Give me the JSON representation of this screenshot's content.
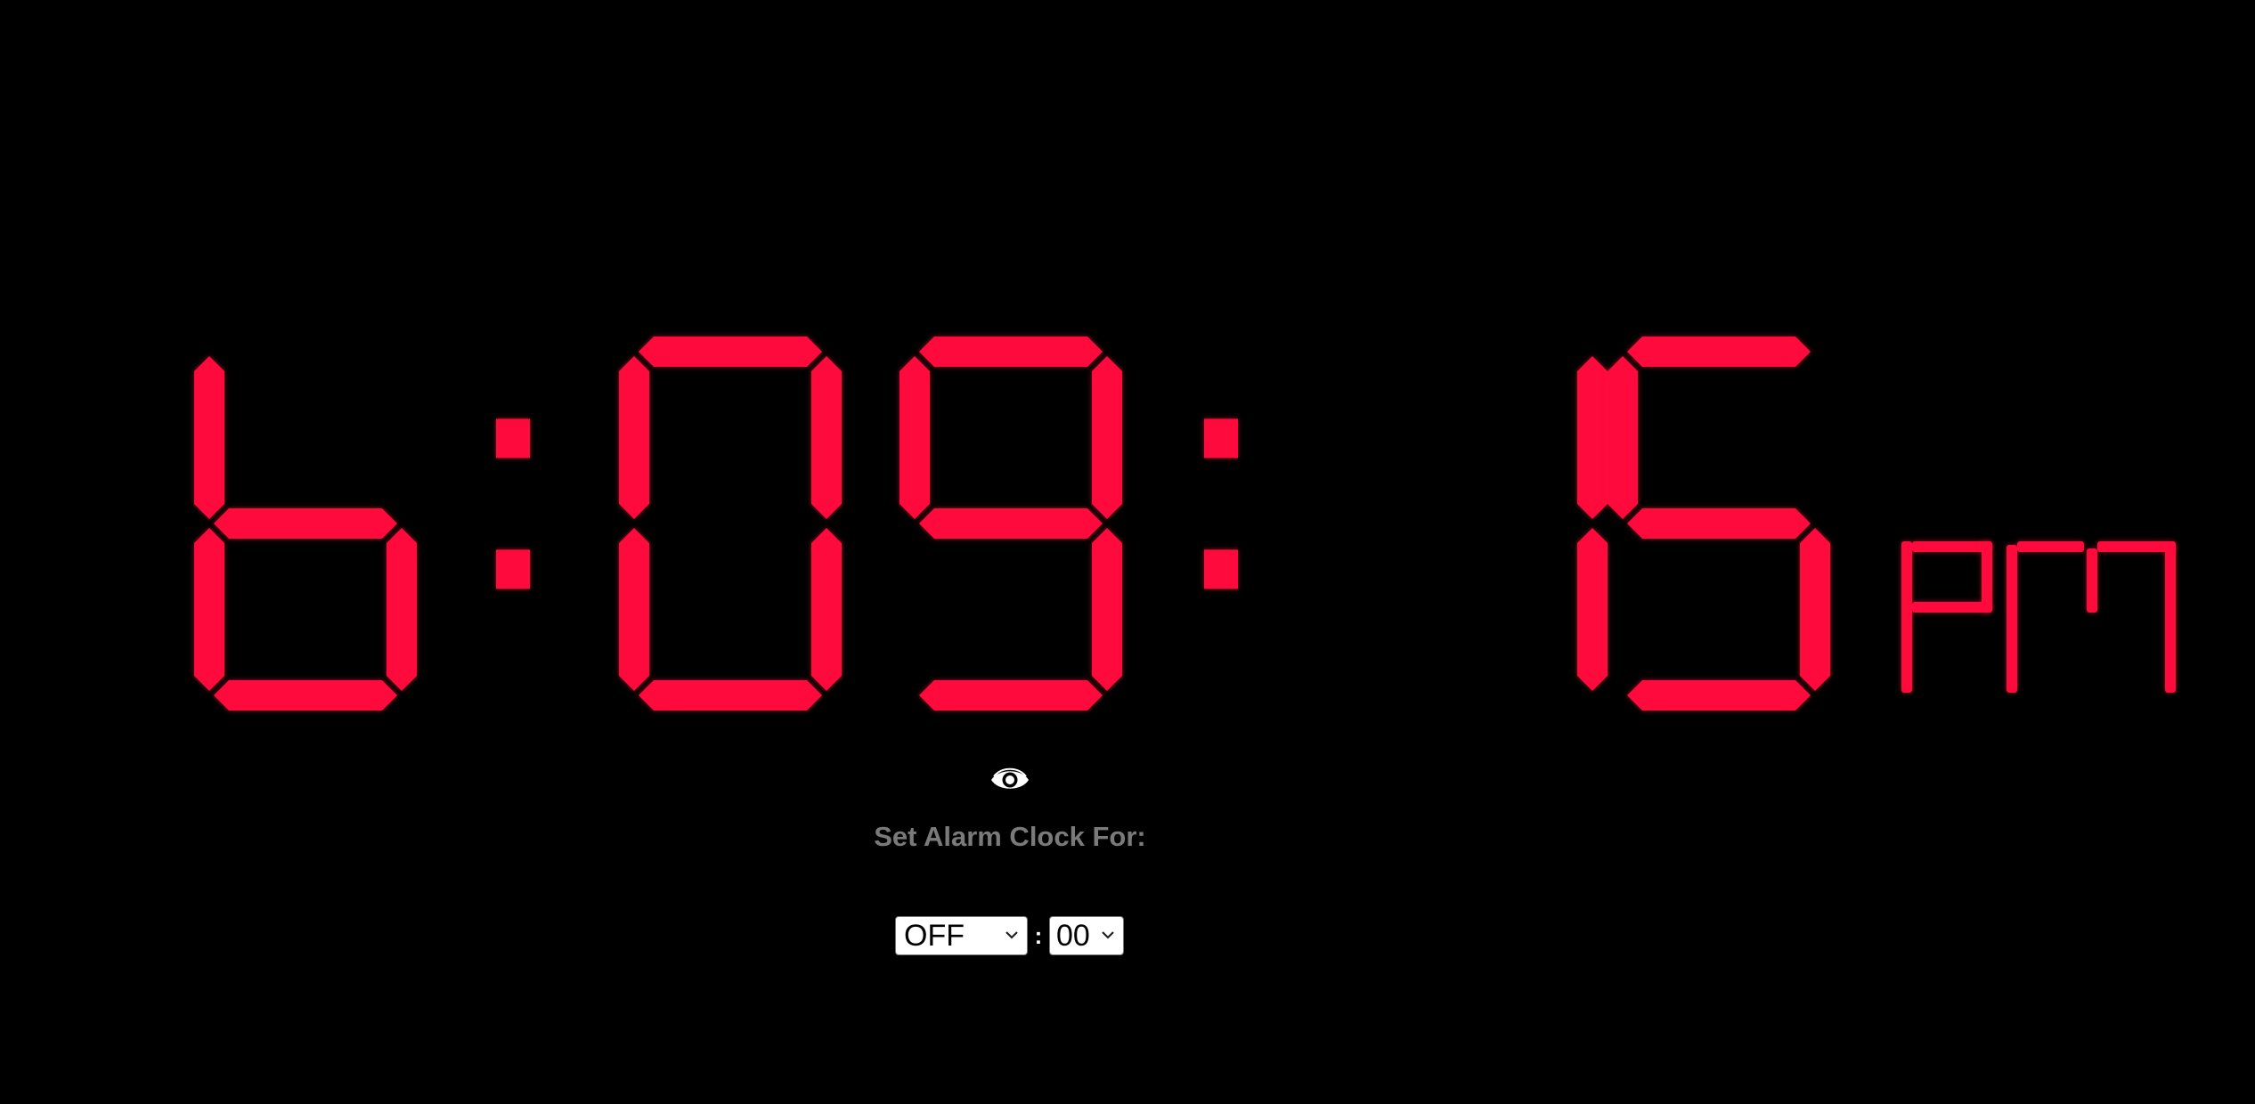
{
  "clock": {
    "hours": "6",
    "minutes": "09",
    "seconds": "15",
    "meridiem": "PM",
    "digit_color": "#ff0a3c"
  },
  "eye_icon": "eye-icon",
  "alarm": {
    "title": "Set Alarm Clock For:",
    "hour_value": "OFF",
    "separator": ":",
    "minute_value": "00"
  }
}
